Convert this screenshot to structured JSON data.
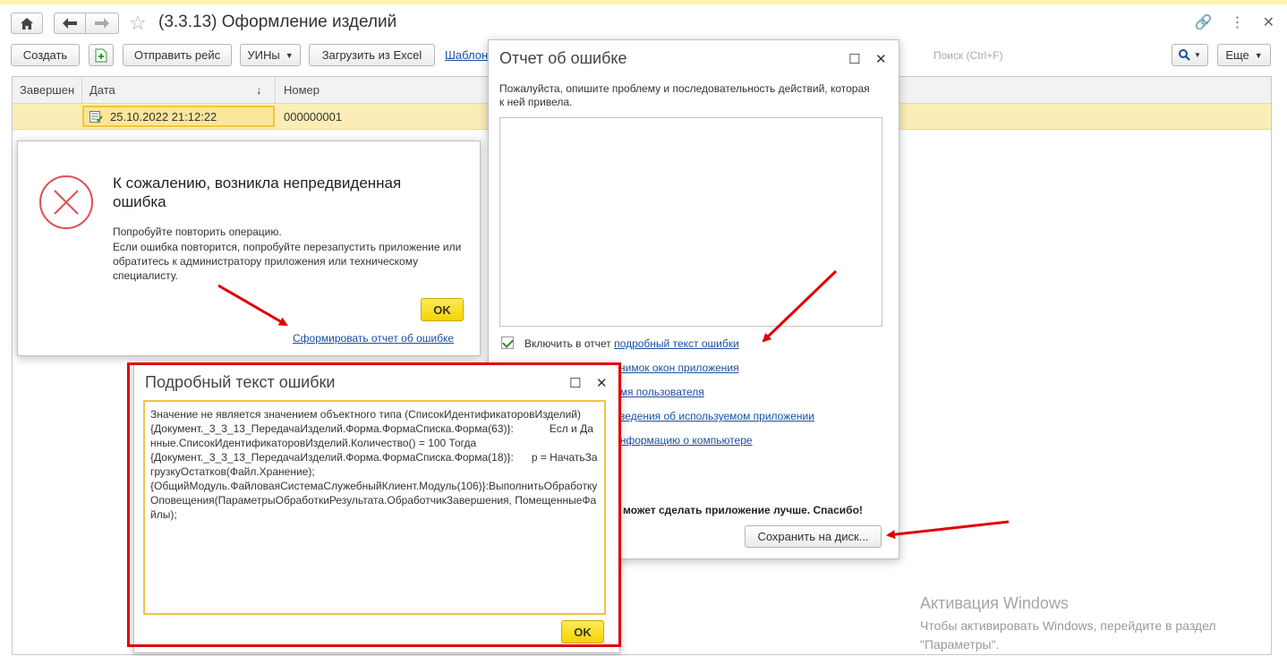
{
  "window": {
    "title": "(3.3.13) Оформление изделий"
  },
  "toolbar": {
    "create": "Создать",
    "send_trip": "Отправить рейс",
    "uins": "УИНы",
    "load_excel": "Загрузить из Excel",
    "template_link": "Шаблон",
    "search_placeholder": "Поиск (Ctrl+F)",
    "more": "Еще"
  },
  "table": {
    "columns": [
      "Завершен",
      "Дата",
      "Номер"
    ],
    "rows": [
      {
        "completed": "",
        "date": "25.10.2022 21:12:22",
        "number": "000000001"
      }
    ]
  },
  "error_dialog": {
    "heading": "К сожалению, возникла непредвиденная ошибка",
    "line1": "Попробуйте повторить операцию.",
    "line2": "Если ошибка повторится, попробуйте перезапустить приложение или обратитесь к администратору приложения или техническому специалисту.",
    "ok": "OK",
    "report_link": "Сформировать отчет об ошибке"
  },
  "report_dialog": {
    "title": "Отчет об ошибке",
    "prompt": "Пожалуйста, опишите проблему и последовательность действий, которая к ней привела.",
    "description_value": "",
    "include_prefix": "Включить в отчет",
    "include_link": "подробный текст ошибки",
    "options": [
      {
        "label": "снимок окон приложения"
      },
      {
        "label": "имя пользователя"
      },
      {
        "label": "сведения об используемом приложении"
      },
      {
        "label": "информацию о компьютере"
      }
    ],
    "thanks": "может сделать приложение лучше. Спасибо!",
    "save_button": "Сохранить на диск..."
  },
  "details_dialog": {
    "title": "Подробный текст ошибки",
    "text": "Значение не является значением объектного типа (СписокИдентификаторовИзделий)\n{Документ._3_3_13_ПередачаИзделий.Форма.ФормаСписка.Форма(63)}:            Есл и Данные.СписокИдентификаторовИзделий.Количество() = 100 Тогда\n{Документ._3_3_13_ПередачаИзделий.Форма.ФормаСписка.Форма(18)}:      р = НачатьЗагрузкуОстатков(Файл.Хранение);\n{ОбщийМодуль.ФайловаяСистемаСлужебныйКлиент.Модуль(106)}:ВыполнитьОбработкуОповещения(ПараметрыОбработкиРезультата.ОбработчикЗавершения, ПомещенныеФайлы);",
    "ok": "OK"
  },
  "watermark": {
    "line1": "Активация Windows",
    "line2": "Чтобы активировать Windows, перейдите в раздел",
    "line3": "\"Параметры\"."
  },
  "colors": {
    "accent_yellow": "#f5d400",
    "row_highlight": "#fbedb6",
    "link_blue": "#1a4fa0",
    "annotation_red": "#e00000"
  }
}
